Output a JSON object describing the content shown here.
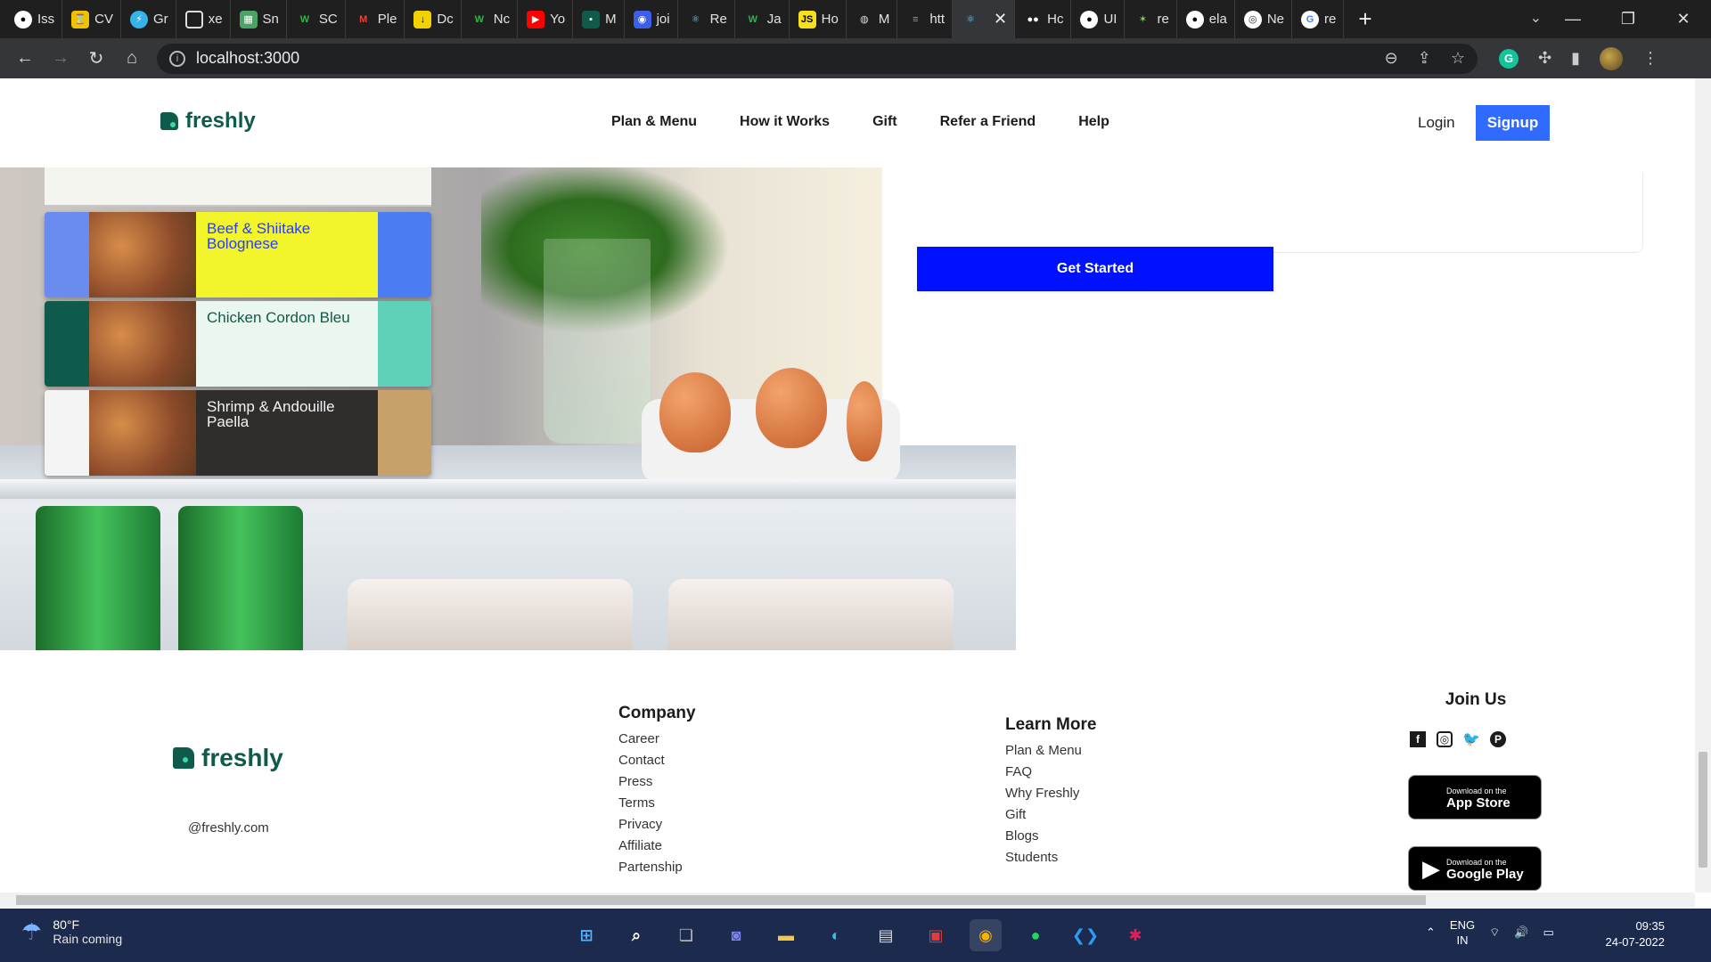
{
  "browser": {
    "tabs": [
      {
        "label": "Iss",
        "icon": "github-icon"
      },
      {
        "label": "CV",
        "icon": "hourglass-icon"
      },
      {
        "label": "Gr",
        "icon": "bolt-icon"
      },
      {
        "label": "xe",
        "icon": "square-icon"
      },
      {
        "label": "Sn",
        "icon": "map-icon"
      },
      {
        "label": "SC",
        "icon": "w-icon"
      },
      {
        "label": "Ple",
        "icon": "gmail-icon"
      },
      {
        "label": "Dc",
        "icon": "download-icon"
      },
      {
        "label": "Nc",
        "icon": "w-icon"
      },
      {
        "label": "Yo",
        "icon": "youtube-icon"
      },
      {
        "label": "M",
        "icon": "app-icon"
      },
      {
        "label": "joi",
        "icon": "meet-icon"
      },
      {
        "label": "Re",
        "icon": "react-icon"
      },
      {
        "label": "Ja",
        "icon": "w-icon"
      },
      {
        "label": "Ho",
        "icon": "js-icon"
      },
      {
        "label": "M",
        "icon": "globe-icon"
      },
      {
        "label": "htt",
        "icon": "stack-icon"
      },
      {
        "label": "",
        "icon": "react-icon",
        "active": true
      },
      {
        "label": "Hc",
        "icon": "medium-icon"
      },
      {
        "label": "UI",
        "icon": "github-icon"
      },
      {
        "label": "re",
        "icon": "spark-icon"
      },
      {
        "label": "ela",
        "icon": "github-icon"
      },
      {
        "label": "Ne",
        "icon": "chrome-icon"
      },
      {
        "label": "re",
        "icon": "google-icon"
      }
    ],
    "url": "localhost:3000"
  },
  "header": {
    "logo_text": "freshly",
    "nav": [
      "Plan & Menu",
      "How it Works",
      "Gift",
      "Refer a Friend",
      "Help"
    ],
    "login": "Login",
    "signup": "Signup"
  },
  "hero": {
    "cta": "Get Started",
    "meals": [
      "Beef & Shiitake Bolognese",
      "Chicken Cordon Bleu",
      "Shrimp & Andouille Paella"
    ]
  },
  "footer": {
    "logo_text": "freshly",
    "email": "@freshly.com",
    "company": {
      "title": "Company",
      "links": [
        "Career",
        "Contact",
        "Press",
        "Terms",
        "Privacy",
        "Affiliate",
        "Partenship"
      ]
    },
    "learn_more": {
      "title": "Learn More",
      "links": [
        "Plan & Menu",
        "FAQ",
        "Why Freshly",
        "Gift",
        "Blogs",
        "Students"
      ]
    },
    "join": {
      "title": "Join Us",
      "socials": [
        "facebook-icon",
        "instagram-icon",
        "twitter-icon",
        "pinterest-icon"
      ],
      "app_store": {
        "small": "Download on the",
        "big": "App Store"
      },
      "google_play": {
        "small": "Download on the",
        "big": "Google Play"
      }
    }
  },
  "taskbar": {
    "weather_temp": "80°F",
    "weather_text": "Rain coming",
    "lang_top": "ENG",
    "lang_bottom": "IN",
    "time": "09:35",
    "date": "24-07-2022"
  }
}
